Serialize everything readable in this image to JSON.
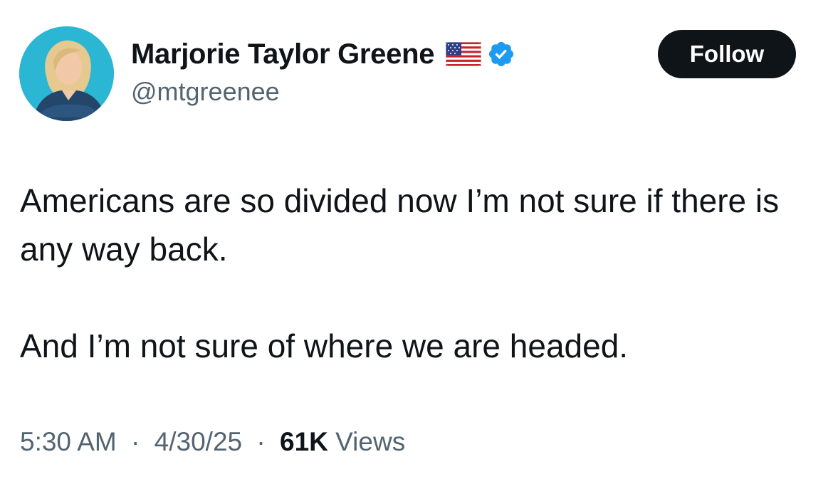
{
  "user": {
    "display_name": "Marjorie Taylor Greene",
    "handle": "@mtgreenee",
    "flag_icon": "us-flag-icon",
    "verified_icon": "verified-badge-icon",
    "verified_color": "#1d9bf0",
    "avatar_bg": "#2bb7d3"
  },
  "follow_button": {
    "label": "Follow"
  },
  "tweet": {
    "paragraphs": [
      "Americans are so divided now I’m not sure if there is any way back.",
      "And I’m not sure of where we are headed."
    ]
  },
  "meta": {
    "time": "5:30 AM",
    "separator": "·",
    "date": "4/30/25",
    "views_count": "61K",
    "views_label": "Views"
  }
}
